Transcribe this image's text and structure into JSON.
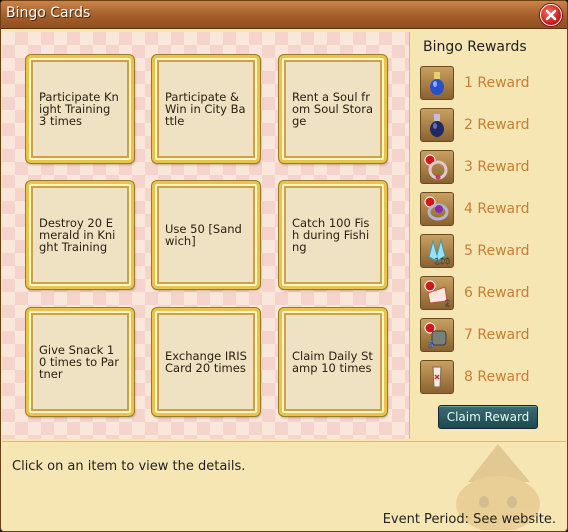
{
  "window": {
    "title": "Bingo Cards"
  },
  "cards": [
    {
      "label": "Participate Knight Training 3 times"
    },
    {
      "label": "Participate & Win in City Battle"
    },
    {
      "label": "Rent a Soul from Soul Storage"
    },
    {
      "label": "Destroy 20 Emerald in Knight Training"
    },
    {
      "label": "Use 50 [Sandwich]"
    },
    {
      "label": "Catch 100 Fish during Fishing"
    },
    {
      "label": "Give Snack 10 times to Partner"
    },
    {
      "label": "Exchange IRIS Card 20 times"
    },
    {
      "label": "Claim Daily Stamp 10 times"
    }
  ],
  "rewards": {
    "title": "Bingo Rewards",
    "items": [
      {
        "label": "1 Reward",
        "icon": "blue-potion-icon"
      },
      {
        "label": "2 Reward",
        "icon": "dark-potion-icon"
      },
      {
        "label": "3 Reward",
        "icon": "pearl-necklace-icon"
      },
      {
        "label": "4 Reward",
        "icon": "gem-bracelet-icon"
      },
      {
        "label": "5 Reward",
        "icon": "crystal-icon",
        "count": "100"
      },
      {
        "label": "6 Reward",
        "icon": "cake-icon",
        "count": "2"
      },
      {
        "label": "7 Reward",
        "icon": "gear-armor-icon",
        "count": "5"
      },
      {
        "label": "8 Reward",
        "icon": "scroll-icon"
      }
    ],
    "claim_label": "Claim Reward"
  },
  "info": {
    "text": "Click on an item to view the details.",
    "event_period": "Event Period: See website."
  }
}
